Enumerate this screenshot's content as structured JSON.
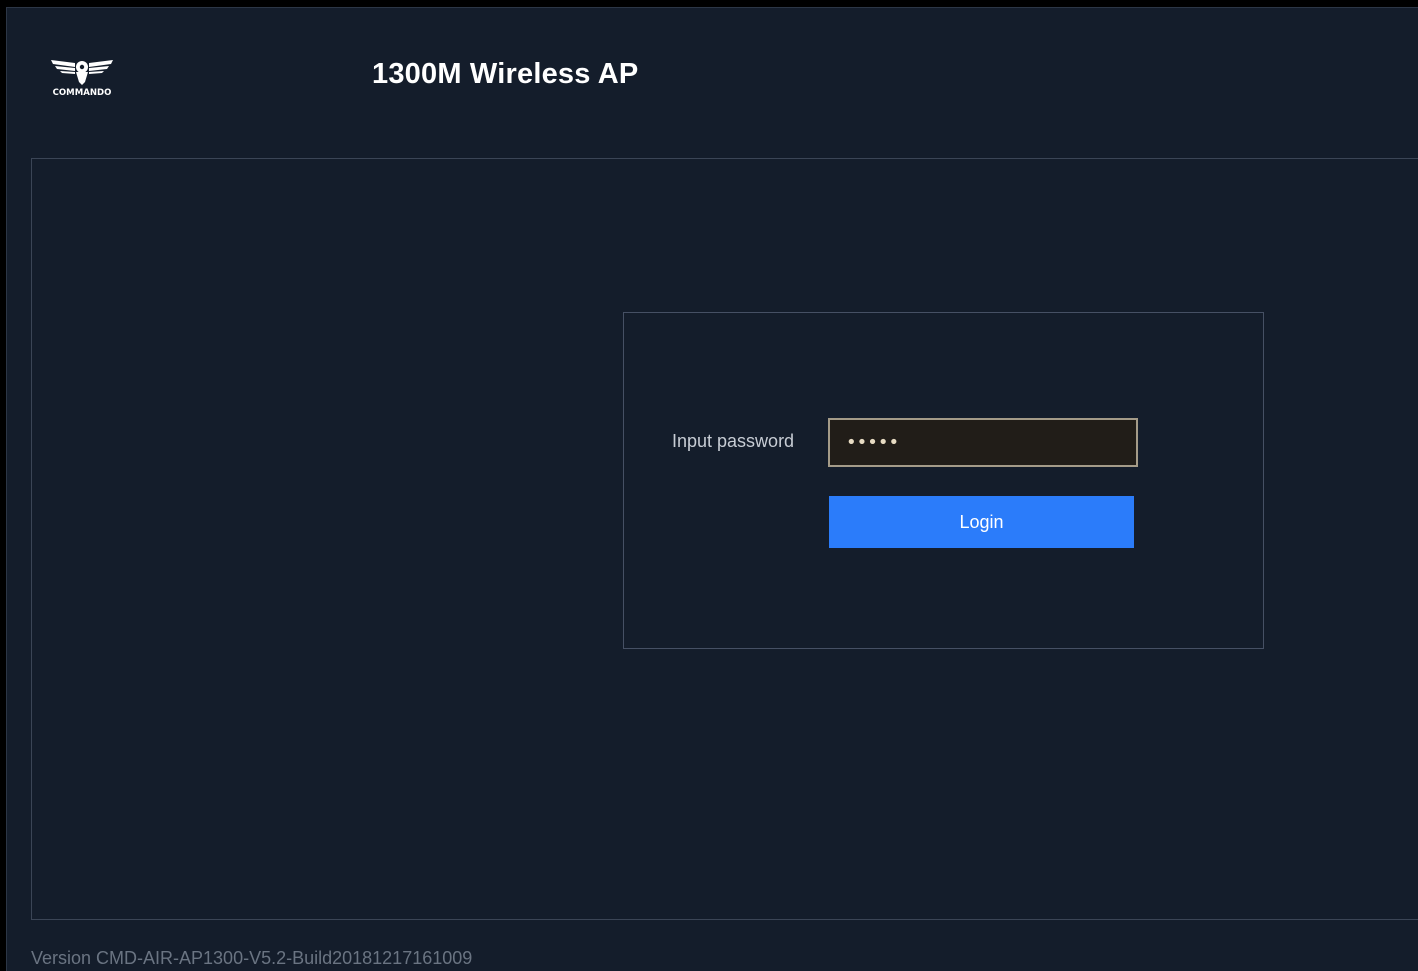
{
  "header": {
    "logo_text": "COMMANDO",
    "title": "1300M Wireless AP"
  },
  "login": {
    "password_label": "Input password",
    "password_value": "•••••",
    "login_label": "Login"
  },
  "footer": {
    "version": "Version CMD-AIR-AP1300-V5.2-Build20181217161009"
  },
  "colors": {
    "background": "#141d2b",
    "accent": "#2b7cfa",
    "input_border": "#a49b88"
  }
}
